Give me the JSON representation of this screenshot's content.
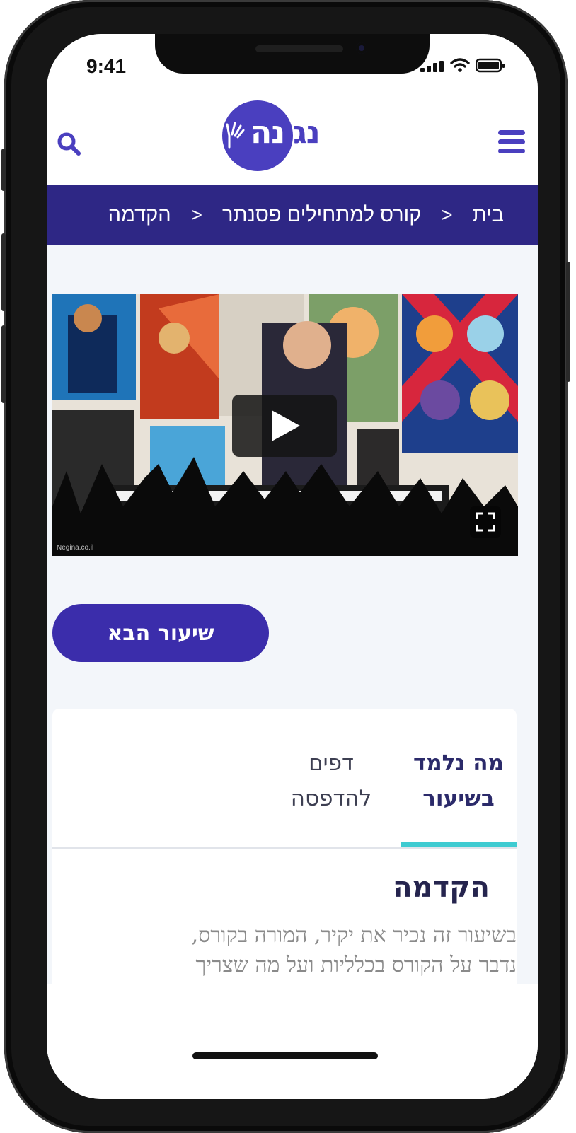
{
  "status_bar": {
    "time": "9:41"
  },
  "header": {
    "logo_text": "נגינה",
    "logo_inner": "נה",
    "logo_outer": "נגי"
  },
  "breadcrumb": {
    "items": [
      "בית",
      "קורס למתחילים פסנתר",
      "הקדמה"
    ],
    "separator": ">"
  },
  "video": {
    "watermark": "Negina.co.il"
  },
  "next_lesson_button": "שיעור הבא",
  "tabs": [
    {
      "label": "מה נלמד בשיעור",
      "line1": "מה נלמד",
      "line2": "בשיעור",
      "active": true
    },
    {
      "label": "דפים להדפסה",
      "line1": "דפים",
      "line2": "להדפסה",
      "active": false
    }
  ],
  "section": {
    "title": "הקדמה",
    "text_line1": "בשיעור זה נכיר את יקיר, המורה בקורס,",
    "text_line2": "נדבר על הקורס בכלליות ועל מה שצריך"
  },
  "colors": {
    "brand_purple": "#4a3fbf",
    "breadcrumb_bg": "#2e2785",
    "button_bg": "#3b2dab",
    "tab_underline": "#3ecbd1",
    "chat_blue": "#1a6fe8"
  },
  "icons": [
    "menu-icon",
    "search-icon",
    "play-icon",
    "fullscreen-icon",
    "chat-icon",
    "signal-icon",
    "wifi-icon",
    "battery-icon"
  ]
}
